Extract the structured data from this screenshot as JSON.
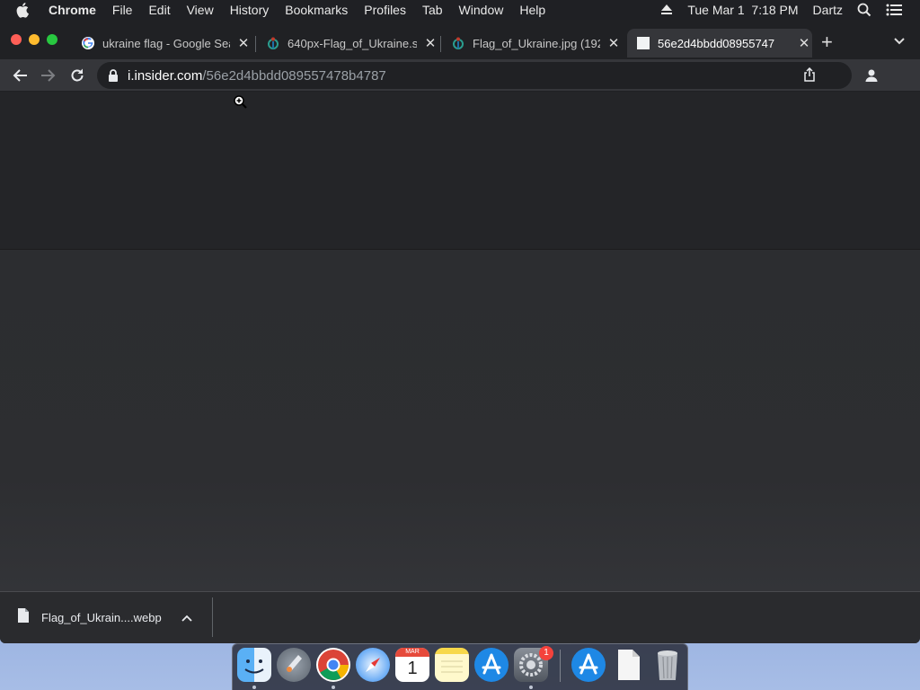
{
  "menubar": {
    "app_name": "Chrome",
    "menus": [
      "File",
      "Edit",
      "View",
      "History",
      "Bookmarks",
      "Profiles",
      "Tab",
      "Window",
      "Help"
    ],
    "datetime": "Tue Mar 1  7:18 PM",
    "user": "Dartz",
    "icons": [
      "apple-icon",
      "eject-icon",
      "spotlight-search-icon",
      "notification-center-icon"
    ]
  },
  "tabs": [
    {
      "title": "ukraine flag - Google Sea",
      "favicon": "google-icon",
      "active": false
    },
    {
      "title": "640px-Flag_of_Ukraine.s",
      "favicon": "wikimedia-icon",
      "active": false
    },
    {
      "title": "Flag_of_Ukraine.jpg (192",
      "favicon": "wikimedia-icon",
      "active": false
    },
    {
      "title": "56e2d4bbdd08955747",
      "favicon": "blank-page-icon",
      "active": true
    }
  ],
  "tab_close_glyph": "✕",
  "newtab_glyph": "+",
  "address_bar": {
    "domain": "i.insider.com",
    "path": "/56e2d4bbdd089557478b4787"
  },
  "download": {
    "filename": "Flag_of_Ukrain....webp"
  },
  "dock": {
    "apps": [
      "Finder",
      "Launchpad",
      "Google Chrome",
      "Safari",
      "Calendar",
      "Notes",
      "App Store",
      "System Preferences",
      "App Store",
      "Document",
      "Trash"
    ],
    "calendar_month": "MAR",
    "calendar_day": "1",
    "badge_count": "1"
  },
  "colors": {
    "tabstrip": "#202124",
    "toolbar": "#35363a",
    "page_top": "#242528",
    "page_bottom": "#333438"
  }
}
